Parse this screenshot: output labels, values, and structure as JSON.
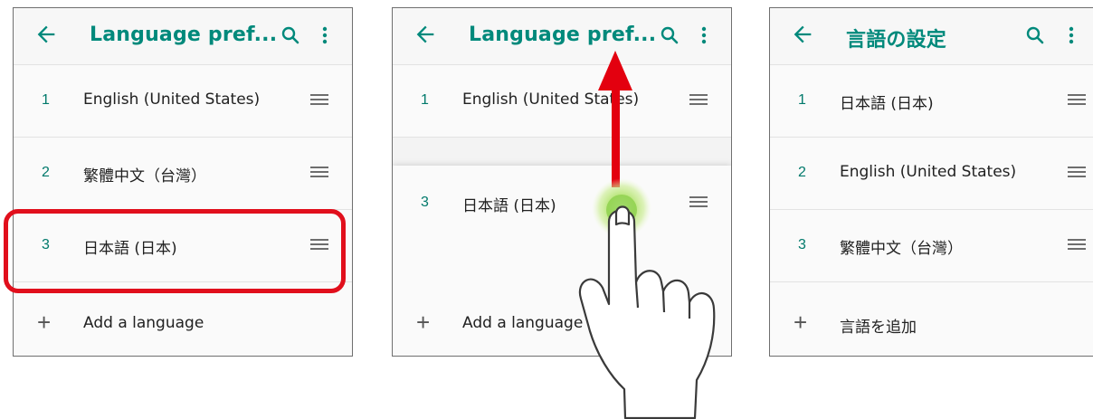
{
  "icons": {
    "back": "arrow-left-icon",
    "search": "search-icon",
    "more": "more-vert-icon",
    "handle": "drag-handle-icon",
    "add": "plus-icon"
  },
  "colors": {
    "accent": "#00897b",
    "highlight": "#e10f1c",
    "arrow": "#e3000f"
  },
  "screen1": {
    "title": "Language pref...",
    "items": [
      {
        "num": "1",
        "label": "English (United States)"
      },
      {
        "num": "2",
        "label": "繁體中文（台灣）"
      },
      {
        "num": "3",
        "label": "日本語 (日本)"
      }
    ],
    "add_symbol": "+",
    "add_label": "Add a language"
  },
  "screen2": {
    "title": "Language pref...",
    "items": [
      {
        "num": "1",
        "label": "English (United States)"
      },
      {
        "num": "3",
        "label": "日本語 (日本)"
      }
    ],
    "add_symbol": "+",
    "add_label": "Add a language"
  },
  "screen3": {
    "title": "言語の設定",
    "items": [
      {
        "num": "1",
        "label": "日本語 (日本)"
      },
      {
        "num": "2",
        "label": "English (United States)"
      },
      {
        "num": "3",
        "label": "繁體中文（台灣）"
      }
    ],
    "add_symbol": "+",
    "add_label": "言語を追加"
  }
}
